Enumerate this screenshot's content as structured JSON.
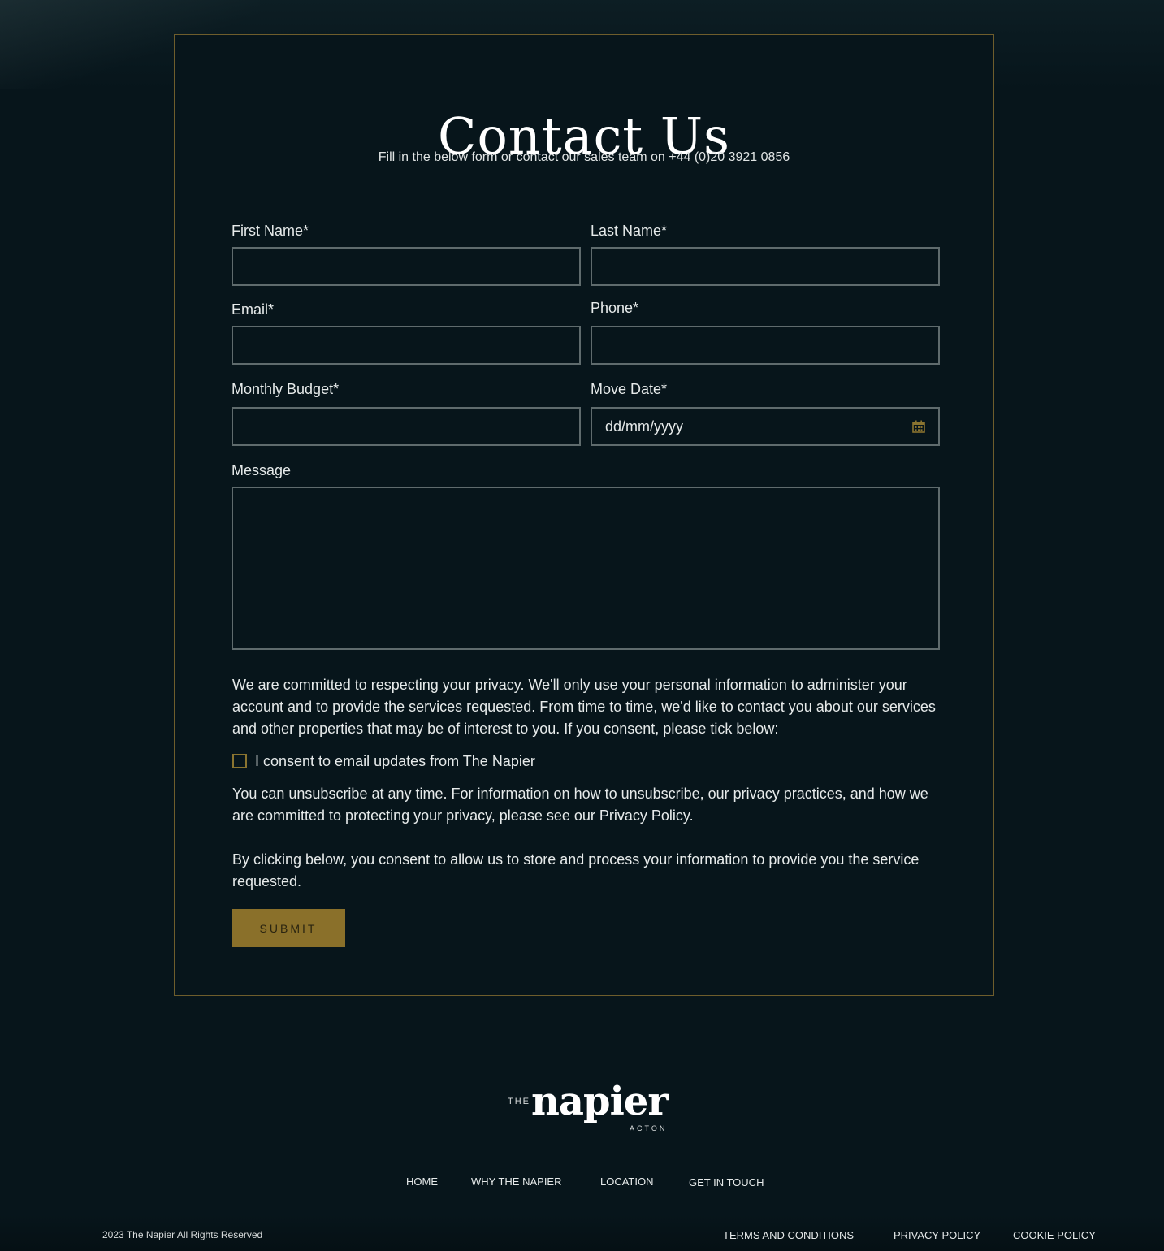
{
  "header": {
    "title": "Contact Us",
    "subtitle": "Fill in the below form or contact our sales team on +44 (0)20 3921 0856"
  },
  "form": {
    "first_name_label": "First Name*",
    "last_name_label": "Last Name*",
    "email_label": "Email*",
    "phone_label": "Phone*",
    "budget_label": "Monthly Budget*",
    "move_date_label": "Move Date*",
    "move_date_placeholder": "dd/mm/yyyy",
    "message_label": "Message",
    "privacy_text": "We are committed to respecting your privacy. We'll only use your personal information to administer your account and to provide the services requested. From time to time, we'd like to contact you about our services and other properties that may be of interest to you. If you consent, please tick below:",
    "consent_label": "I consent to email updates from The Napier",
    "consent_checked": false,
    "unsubscribe_text": "You can unsubscribe at any time. For information on how to unsubscribe, our privacy practices, and how we are committed to protecting your privacy, please see our Privacy Policy.",
    "storage_consent_text": "By clicking below, you consent to allow us to store and process your information to provide you the service requested.",
    "submit_label": "SUBMIT"
  },
  "footer": {
    "logo": {
      "the": "THE",
      "name": "napier",
      "location": "ACTON"
    },
    "nav": [
      "HOME",
      "WHY THE NAPIER",
      "LOCATION",
      "GET IN TOUCH"
    ],
    "copyright": "2023 The Napier All Rights Reserved",
    "legal": [
      "TERMS AND CONDITIONS",
      "PRIVACY POLICY",
      "COOKIE POLICY"
    ]
  },
  "colors": {
    "background": "#07151b",
    "accent_gold": "#8a702a",
    "card_border": "#6e5d2c",
    "input_border": "#5f6b6d",
    "text": "#e6eaea"
  },
  "icons": {
    "date_picker": "calendar-icon"
  }
}
